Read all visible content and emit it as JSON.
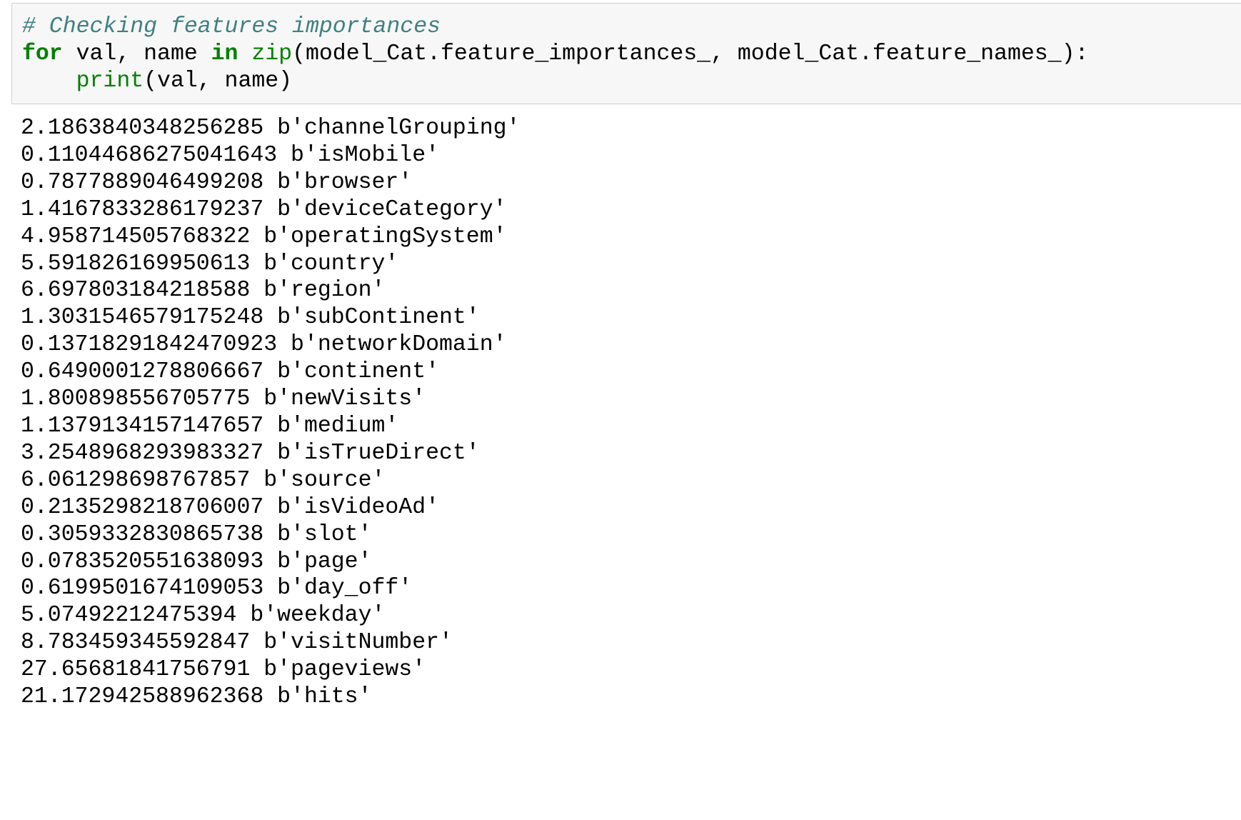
{
  "input_cell": {
    "line1_comment": "# Checking features importances",
    "line2": {
      "kw_for": "for",
      "text_a": " val, name ",
      "kw_in": "in",
      "text_b": " ",
      "builtin_zip": "zip",
      "text_c": "(model_Cat.feature_importances_, model_Cat.feature_names_):"
    },
    "line3": {
      "indent": "    ",
      "builtin_print": "print",
      "text": "(val, name)"
    }
  },
  "output_lines": [
    "2.1863840348256285 b'channelGrouping'",
    "0.11044686275041643 b'isMobile'",
    "0.7877889046499208 b'browser'",
    "1.4167833286179237 b'deviceCategory'",
    "4.958714505768322 b'operatingSystem'",
    "5.591826169950613 b'country'",
    "6.697803184218588 b'region'",
    "1.3031546579175248 b'subContinent'",
    "0.13718291842470923 b'networkDomain'",
    "0.6490001278806667 b'continent'",
    "1.800898556705775 b'newVisits'",
    "1.1379134157147657 b'medium'",
    "3.2548968293983327 b'isTrueDirect'",
    "6.061298698767857 b'source'",
    "0.2135298218706007 b'isVideoAd'",
    "0.3059332830865738 b'slot'",
    "0.0783520551638093 b'page'",
    "0.6199501674109053 b'day_off'",
    "5.07492212475394 b'weekday'",
    "8.783459345592847 b'visitNumber'",
    "27.65681841756791 b'pageviews'",
    "21.172942588962368 b'hits'"
  ],
  "colors": {
    "cell_background": "#f7f7f7",
    "cell_border": "#cfcfcf",
    "comment": "#408080",
    "keyword": "#008000",
    "builtin": "#008000",
    "text": "#000000"
  }
}
